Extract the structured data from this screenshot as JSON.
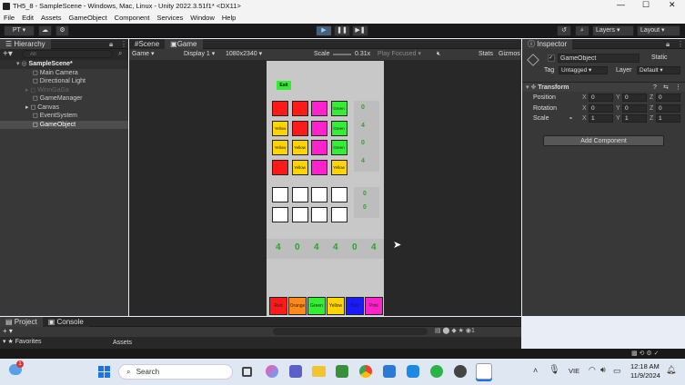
{
  "window": {
    "title": "TH5_8 - SampleScene - Windows, Mac, Linux - Unity 2022.3.51f1* <DX11>"
  },
  "menu": [
    "File",
    "Edit",
    "Assets",
    "GameObject",
    "Component",
    "Services",
    "Window",
    "Help"
  ],
  "toolbar": {
    "account": "PT ▾",
    "layers": "Layers",
    "layout": "Layout"
  },
  "hierarchy": {
    "tab": "Hierarchy",
    "search_placeholder": "All",
    "scene": "SampleScene*",
    "items": [
      "Main Camera",
      "Directional Light",
      "WinnGaGa",
      "GameManager",
      "Canvas",
      "EventSystem",
      "GameObject"
    ]
  },
  "game": {
    "tabs": [
      "Scene",
      "Game"
    ],
    "mode": "Game",
    "display": "Display 1",
    "resolution": "1080x2340",
    "scale_label": "Scale",
    "scale_value": "0.31x",
    "play_focused": "Play Focused",
    "stats": "Stats",
    "gizmos": "Gizmos"
  },
  "board": {
    "exit": "Exit",
    "grid": [
      [
        "#ff1a1a",
        "#ff1a1a",
        "#ff22cc",
        "#33ee33"
      ],
      [
        "#ffd400",
        "#ff1a1a",
        "#ff22cc",
        "#33ee33"
      ],
      [
        "#ffd400",
        "#ffd400",
        "#ff22cc",
        "#33ee33"
      ],
      [
        "#ff1a1a",
        "#ffd400",
        "#ff22cc",
        "#ffd400"
      ]
    ],
    "grid_labels": [
      [
        "",
        "",
        "",
        "Green"
      ],
      [
        "Yellow",
        "",
        "",
        "Green"
      ],
      [
        "Yellow",
        "Yellow",
        "",
        "Green"
      ],
      [
        "",
        "Yellow",
        "",
        "Yellow"
      ]
    ],
    "side_counts": [
      "0",
      "4",
      "0",
      "4"
    ],
    "answer_hints": [
      "0",
      "0"
    ],
    "results": [
      "4",
      "0",
      "4",
      "4",
      "0",
      "4"
    ],
    "palette": [
      {
        "label": "Red",
        "color": "#ff1a1a"
      },
      {
        "label": "Orange",
        "color": "#ff8a1a"
      },
      {
        "label": "Green",
        "color": "#33ee33"
      },
      {
        "label": "Yellow",
        "color": "#ffd400"
      },
      {
        "label": "Blue",
        "color": "#1a1aff"
      },
      {
        "label": "Pink",
        "color": "#ff22cc"
      }
    ]
  },
  "inspector": {
    "tab": "Inspector",
    "name": "GameObject",
    "static": "Static",
    "tag_label": "Tag",
    "tag": "Untagged",
    "layer_label": "Layer",
    "layer": "Default",
    "component": "Transform",
    "rows": [
      {
        "label": "Position",
        "x": "0",
        "y": "0",
        "z": "0"
      },
      {
        "label": "Rotation",
        "x": "0",
        "y": "0",
        "z": "0"
      },
      {
        "label": "Scale",
        "x": "1",
        "y": "1",
        "z": "1"
      }
    ],
    "add_component": "Add Component"
  },
  "bottom": {
    "tabs": [
      "Project",
      "Console"
    ],
    "favorites": "Favorites",
    "assets": "Assets"
  },
  "taskbar": {
    "search": "Search",
    "lang": "VIE",
    "time": "12:18 AM",
    "date": "11/9/2024",
    "badge": "1"
  }
}
